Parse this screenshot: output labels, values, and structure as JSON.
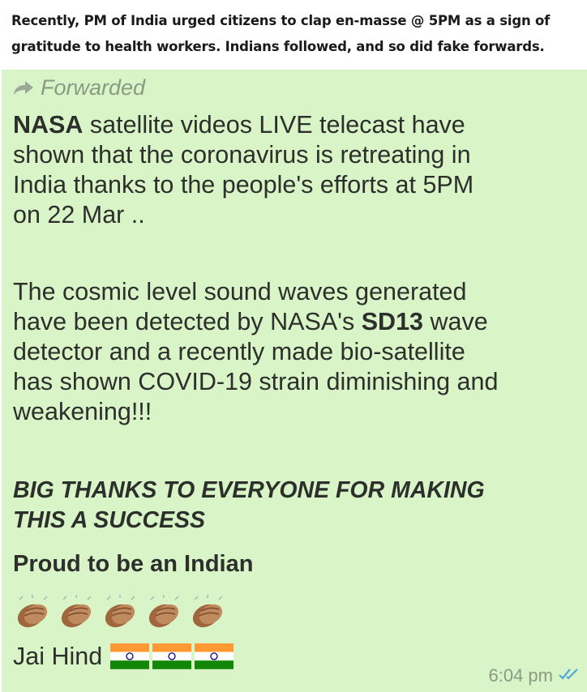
{
  "caption": {
    "line1": "Recently, PM of India urged citizens to clap en-masse @ 5PM as a sign of",
    "line2": "gratitude to health workers. Indians followed, and so did fake forwards."
  },
  "message": {
    "forwarded_label": "Forwarded",
    "p1": {
      "bold_lead": "NASA",
      "l1_rest": " satellite videos LIVE telecast have",
      "l2": "shown that the coronavirus is retreating in",
      "l3": "India thanks to the people's efforts at 5PM",
      "l4": "on 22 Mar .."
    },
    "p2": {
      "l1": "The cosmic level sound waves generated",
      "l2_pre": "have been detected by NASA's ",
      "l2_bold": "SD13",
      "l2_post": " wave",
      "l3": "detector and a recently made bio-satellite",
      "l4": "has shown COVID-19 strain diminishing and",
      "l5": "weakening!!!"
    },
    "p3": {
      "l1": "BIG THANKS TO EVERYONE FOR MAKING",
      "l2": "THIS A SUCCESS"
    },
    "p4": "Proud to be an Indian",
    "emojis": [
      "clapping-hands",
      "clapping-hands",
      "clapping-hands",
      "clapping-hands",
      "clapping-hands"
    ],
    "jai_hind": "Jai Hind",
    "flags": [
      "india-flag",
      "india-flag",
      "india-flag"
    ],
    "time": "6:04 pm",
    "read_status": "double-check-icon"
  },
  "colors": {
    "bubble_bg": "#d9f4c7",
    "text": "#2c2f2b",
    "meta": "#8a9a85",
    "tick": "#4fa8d8",
    "saffron": "#ff9933",
    "green": "#138808",
    "chakra": "#000080"
  }
}
